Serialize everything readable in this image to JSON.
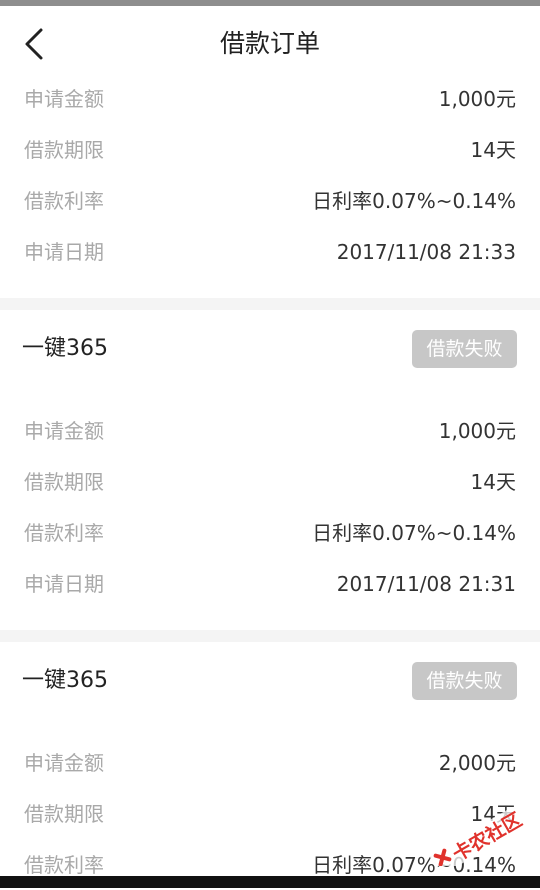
{
  "header": {
    "title": "借款订单",
    "back_icon": "chevron-left-icon"
  },
  "first_order_details": [
    {
      "label": "申请金额",
      "value": "1,000元"
    },
    {
      "label": "借款期限",
      "value": "14天"
    },
    {
      "label": "借款利率",
      "value": "日利率0.07%~0.14%"
    },
    {
      "label": "申请日期",
      "value": "2017/11/08 21:33"
    }
  ],
  "orders": [
    {
      "name": "一键365",
      "status": "借款失败",
      "details": [
        {
          "label": "申请金额",
          "value": "1,000元"
        },
        {
          "label": "借款期限",
          "value": "14天"
        },
        {
          "label": "借款利率",
          "value": "日利率0.07%~0.14%"
        },
        {
          "label": "申请日期",
          "value": "2017/11/08 21:31"
        }
      ]
    },
    {
      "name": "一键365",
      "status": "借款失败",
      "details": [
        {
          "label": "申请金额",
          "value": "2,000元"
        },
        {
          "label": "借款期限",
          "value": "14天"
        },
        {
          "label": "借款利率",
          "value": "日利率0.07%~0.14%"
        }
      ]
    }
  ],
  "watermark": {
    "text": "卡农社区",
    "color": "#e0322c"
  },
  "colors": {
    "label": "#a9a9a9",
    "value": "#333333",
    "badge_bg": "#c7c7c7",
    "divider": "#f4f4f4"
  }
}
